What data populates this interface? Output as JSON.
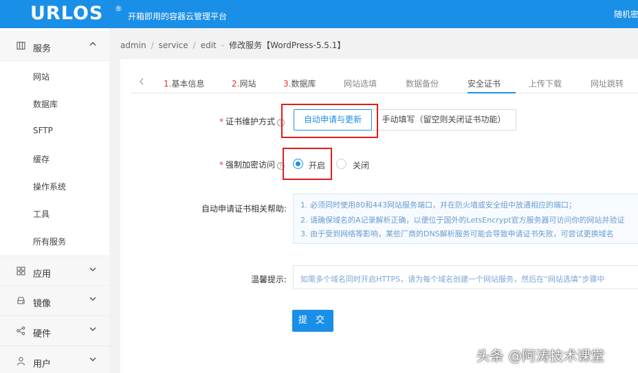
{
  "header": {
    "logo": "URLOS",
    "logo_mark": "®",
    "slogan": "开箱即用的容器云管理平台",
    "right_text": "随机密"
  },
  "sidebar": {
    "groups": [
      {
        "label": "服务",
        "icon": "server-icon",
        "expanded": true
      },
      {
        "label": "应用",
        "icon": "grid-icon",
        "expanded": false
      },
      {
        "label": "镜像",
        "icon": "disk-icon",
        "expanded": false
      },
      {
        "label": "硬件",
        "icon": "share-icon",
        "expanded": false
      },
      {
        "label": "用户",
        "icon": "user-icon",
        "expanded": false
      }
    ],
    "service_items": [
      "网站",
      "数据库",
      "SFTP",
      "缓存",
      "操作系统",
      "工具",
      "所有服务"
    ]
  },
  "breadcrumb": {
    "items": [
      "admin",
      "service",
      "edit"
    ],
    "current": "修改服务【WordPress-5.5.1】"
  },
  "tabs": [
    {
      "num": "1.",
      "label": "基本信息"
    },
    {
      "num": "2.",
      "label": "网站"
    },
    {
      "num": "3.",
      "label": "数据库"
    },
    {
      "num": "",
      "label": "网站选填"
    },
    {
      "num": "",
      "label": "数据备份"
    },
    {
      "num": "",
      "label": "安全证书",
      "active": true
    },
    {
      "num": "",
      "label": "上传下载"
    },
    {
      "num": "",
      "label": "网址跳转"
    }
  ],
  "form": {
    "cert_mode_label": "证书维护方式",
    "cert_mode_options": [
      "自动申请与更新",
      "手动填写（留空则关闭证书功能）"
    ],
    "cert_mode_selected": "自动申请与更新",
    "force_https_label": "强制加密访问",
    "force_https_options": [
      "开启",
      "关闭"
    ],
    "force_https_selected": "开启",
    "help_label": "自动申请证书相关帮助:",
    "help_lines": [
      "1. 必须同时使用80和443网站服务端口，并在防火墙或安全组中放通相应的端口；",
      "2. 请确保域名的A记录解析正确，以便位于国外的LetsEncrypt官方服务器可访问你的网站并验证",
      "3. 由于受到网络等影响，某些厂商的DNS解析服务可能会导致申请证书失败，可尝试更换域名"
    ],
    "tip_label": "温馨提示:",
    "tip_text": "如需多个域名同时开启HTTPS，请为每个域名创建一个网站服务，然后在“网站选填”步骤中",
    "submit_label": "提 交"
  },
  "watermark": "头条 @阿涛技术课堂",
  "colors": {
    "primary": "#1a8fe8",
    "highlight": "#e01b1b",
    "required": "#e33333"
  }
}
